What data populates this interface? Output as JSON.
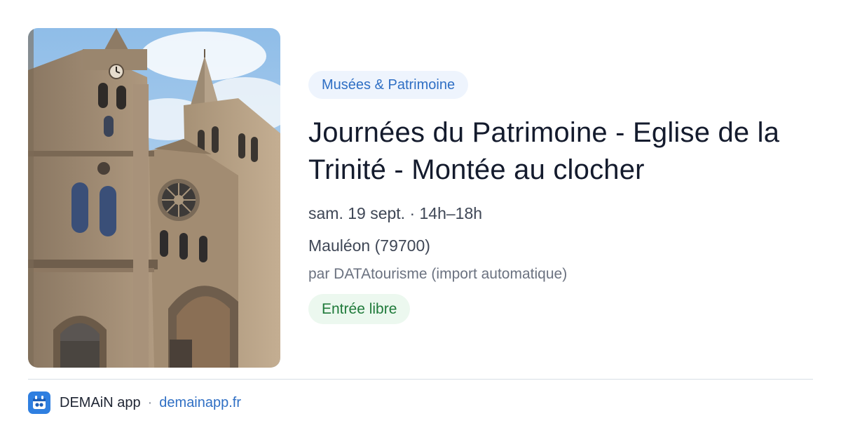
{
  "card": {
    "category": "Musées & Patrimoine",
    "title": "Journées du Patrimoine - Eglise de la Trinité - Montée au clocher",
    "when": "sam. 19 sept. · 14h–18h",
    "where": "Mauléon (79700)",
    "source": "par DATAtourisme (import automatique)",
    "price": "Entrée libre"
  },
  "footer": {
    "app_name": "DEMAiN app",
    "separator": "·",
    "domain": "demainapp.fr"
  },
  "icons": {
    "logo": "demain-app-icon",
    "photo": "church-photo"
  },
  "colors": {
    "category_bg": "#eef4fd",
    "category_text": "#2f6fc4",
    "title_text": "#141b2d",
    "price_bg": "#ecf8ef",
    "price_text": "#1f7a3a",
    "link": "#2f6fc4",
    "logo_bg": "#2f7fe0"
  }
}
